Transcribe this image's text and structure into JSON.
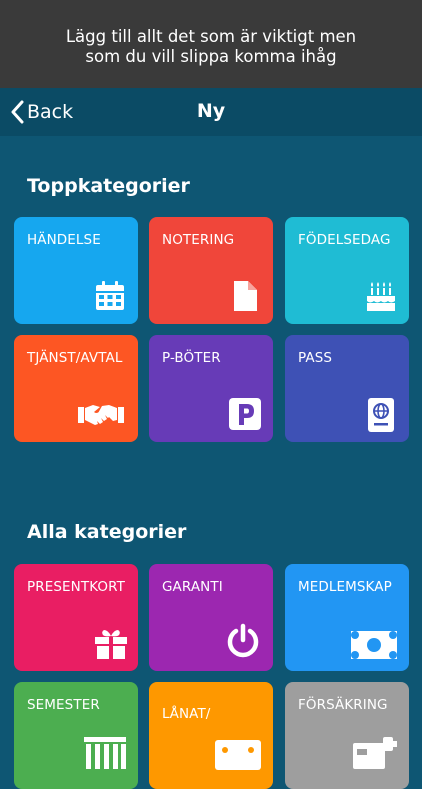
{
  "promo": {
    "line1": "Lägg till allt det som är viktigt men",
    "line2": "som du vill slippa komma ihåg"
  },
  "nav": {
    "back_label": "Back",
    "title": "Ny"
  },
  "sections": {
    "top": {
      "title": "Toppkategorier"
    },
    "all": {
      "title": "Alla kategorier"
    }
  },
  "top_categories": [
    {
      "label": "HÄNDELSE",
      "icon": "calendar-icon",
      "color": "#16a7ef"
    },
    {
      "label": "NOTERING",
      "icon": "document-icon",
      "color": "#f0463a"
    },
    {
      "label": "FÖDELSEDAG",
      "icon": "birthday-cake-icon",
      "color": "#1fbcd4"
    },
    {
      "label": "TJÄNST/AVTAL",
      "icon": "handshake-icon",
      "color": "#fd5623"
    },
    {
      "label": "P-BÖTER",
      "icon": "parking-icon",
      "color": "#673bb7"
    },
    {
      "label": "PASS",
      "icon": "passport-icon",
      "color": "#3e51b5"
    }
  ],
  "all_categories": [
    {
      "label": "PRESENTKORT",
      "icon": "gift-icon",
      "color": "#e91e63"
    },
    {
      "label": "GARANTI",
      "icon": "power-icon",
      "color": "#9c27b0"
    },
    {
      "label": "MEDLEMSKAP",
      "icon": "money-card-icon",
      "color": "#2296f3"
    },
    {
      "label": "SEMESTER",
      "icon": "building-icon",
      "color": "#4cae50"
    },
    {
      "label": "LÅNAT/",
      "icon": "borrowed-icon",
      "color": "#fe9800"
    },
    {
      "label": "FÖRSÄKRING",
      "icon": "insurance-icon",
      "color": "#9e9e9e"
    }
  ]
}
